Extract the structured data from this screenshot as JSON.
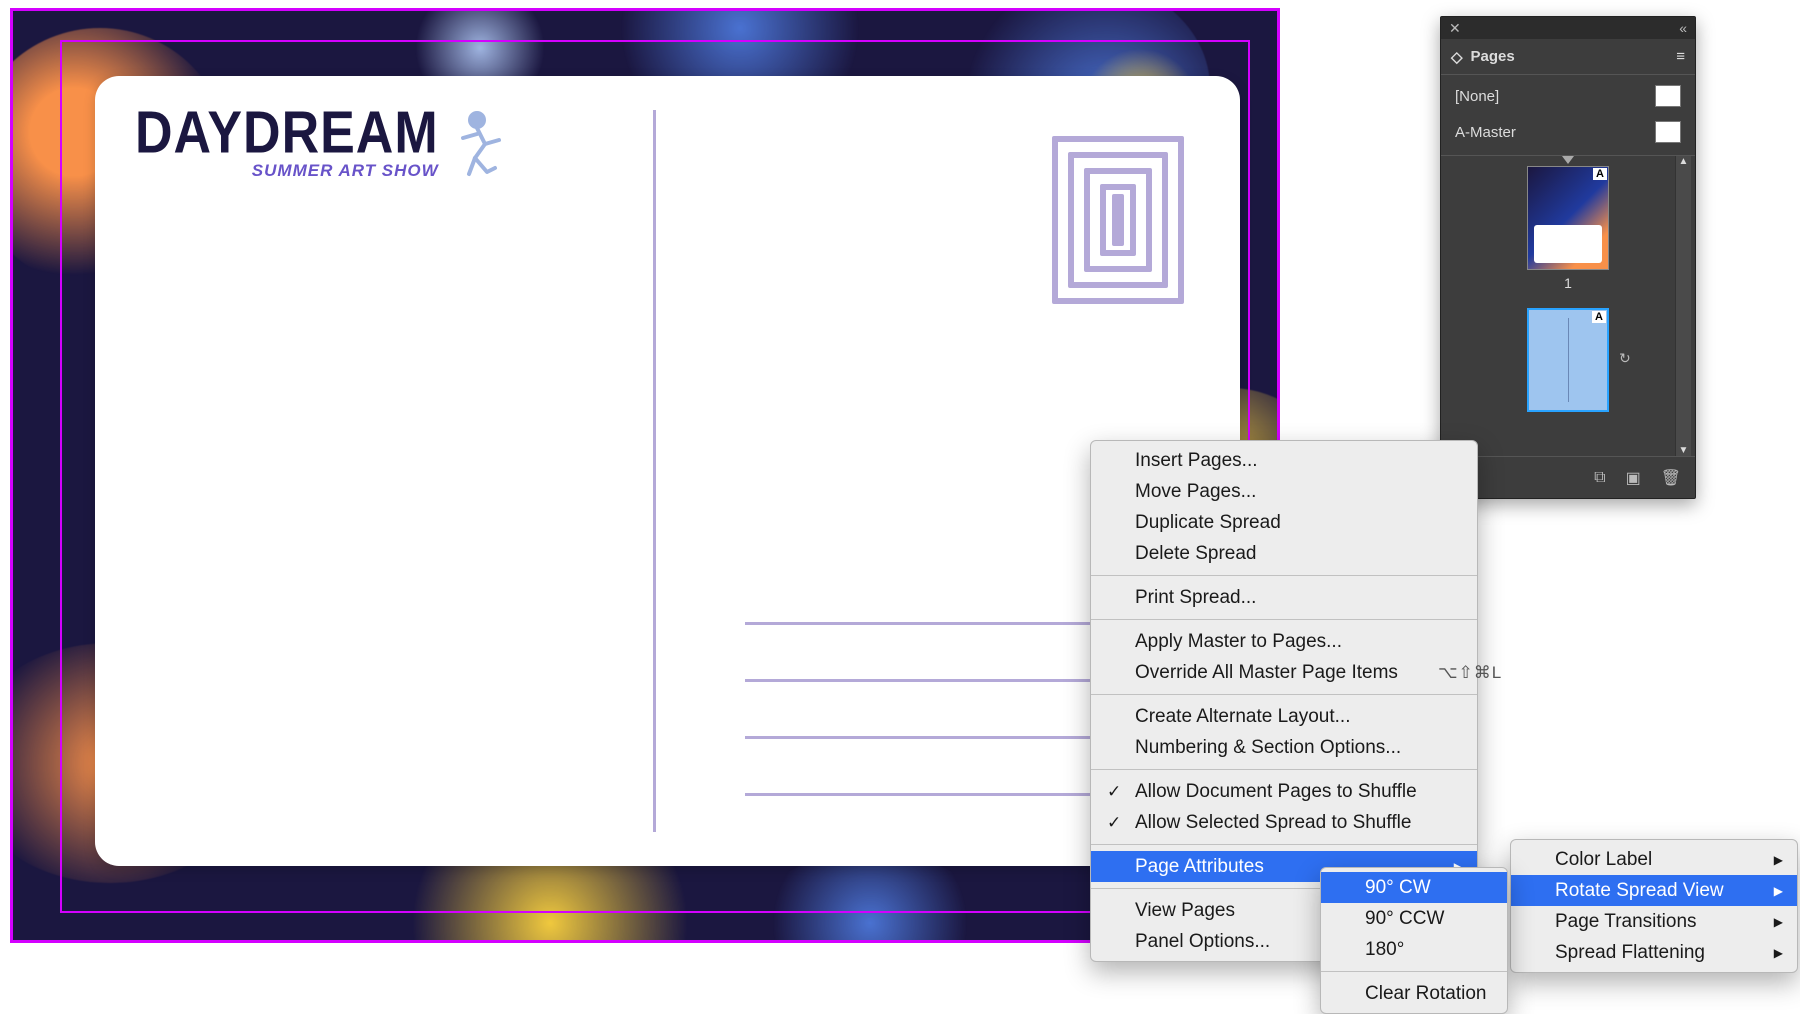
{
  "panel": {
    "title": "Pages",
    "masters": [
      "[None]",
      "A-Master"
    ],
    "page_label_a": "A",
    "page_number_1": "1"
  },
  "postcard": {
    "logo_title": "DAYDREAM",
    "logo_sub": "SUMMER ART SHOW"
  },
  "ctx_main": [
    {
      "label": "Insert Pages...",
      "type": "item"
    },
    {
      "label": "Move Pages...",
      "type": "item"
    },
    {
      "label": "Duplicate Spread",
      "type": "item"
    },
    {
      "label": "Delete Spread",
      "type": "item"
    },
    {
      "type": "sep"
    },
    {
      "label": "Print Spread...",
      "type": "item"
    },
    {
      "type": "sep"
    },
    {
      "label": "Apply Master to Pages...",
      "type": "item"
    },
    {
      "label": "Override All Master Page Items",
      "type": "item",
      "shortcut": "⌥⇧⌘L"
    },
    {
      "type": "sep"
    },
    {
      "label": "Create Alternate Layout...",
      "type": "item"
    },
    {
      "label": "Numbering & Section Options...",
      "type": "item"
    },
    {
      "type": "sep"
    },
    {
      "label": "Allow Document Pages to Shuffle",
      "type": "item",
      "checked": true
    },
    {
      "label": "Allow Selected Spread to Shuffle",
      "type": "item",
      "checked": true
    },
    {
      "type": "sep"
    },
    {
      "label": "Page Attributes",
      "type": "item",
      "arrow": true,
      "highlight": true
    },
    {
      "type": "sep"
    },
    {
      "label": "View Pages",
      "type": "item",
      "arrow": true
    },
    {
      "label": "Panel Options...",
      "type": "item"
    }
  ],
  "ctx_sub1": [
    {
      "label": "90° CW",
      "highlight": true
    },
    {
      "label": "90° CCW"
    },
    {
      "label": "180°"
    },
    {
      "type": "sep"
    },
    {
      "label": "Clear Rotation"
    }
  ],
  "ctx_sub2": [
    {
      "label": "Color Label",
      "arrow": true
    },
    {
      "label": "Rotate Spread View",
      "arrow": true,
      "highlight": true
    },
    {
      "label": "Page Transitions",
      "arrow": true
    },
    {
      "label": "Spread Flattening",
      "arrow": true
    }
  ]
}
